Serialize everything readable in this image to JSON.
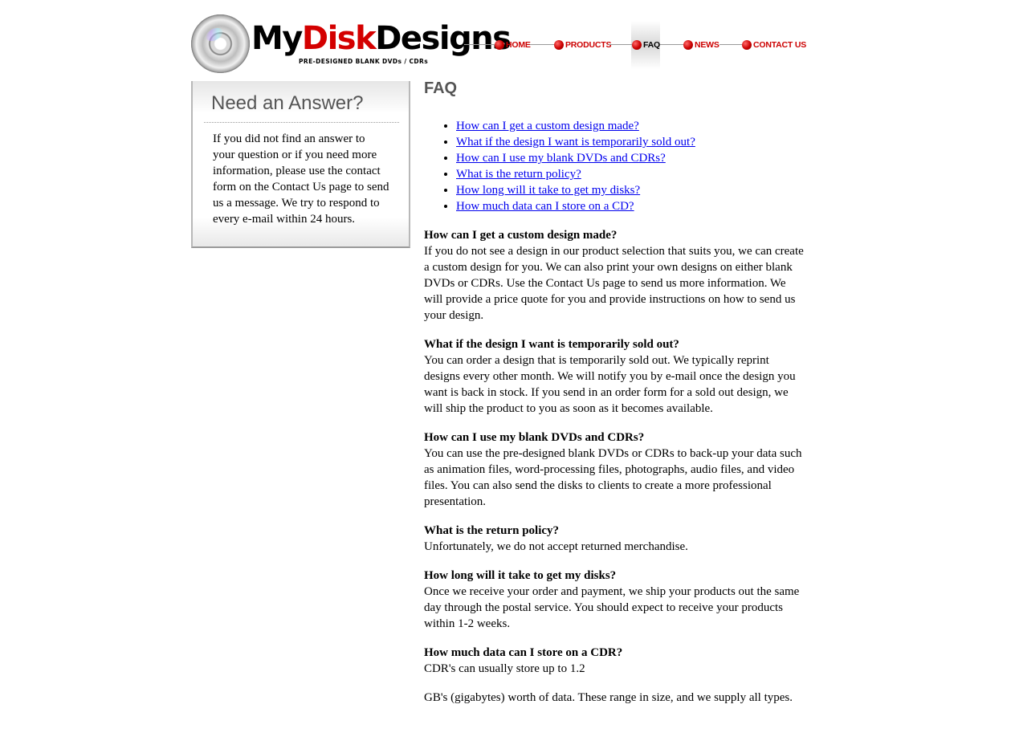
{
  "header": {
    "logo": {
      "my": "My",
      "disk": "Disk",
      "designs": "Designs"
    },
    "tagline": "PRE-DESIGNED BLANK DVDs / CDRs",
    "disc_icon": "cd-disc-icon"
  },
  "nav": {
    "items": [
      {
        "label": "HOME",
        "active": false
      },
      {
        "label": "PRODUCTS",
        "active": false
      },
      {
        "label": "FAQ",
        "active": true
      },
      {
        "label": "NEWS",
        "active": false
      },
      {
        "label": "CONTACT US",
        "active": false
      }
    ],
    "colors": {
      "accent": "#cc0000",
      "active_text": "#000000"
    }
  },
  "sidebar": {
    "title": "Need an Answer?",
    "text": "If you did not find an answer to your question or if you need more information, please use the contact form on the Contact Us page to send us a message. We try to respond to every e-mail within 24 hours."
  },
  "main": {
    "title": "FAQ",
    "toc": [
      "How can I get a custom design made?",
      "What if the design I want is temporarily sold out?",
      "How can I use my blank DVDs and CDRs?",
      "What is the return policy?",
      "How long will it take to get my disks?",
      "How much data can I store on a CD?"
    ],
    "faqs": [
      {
        "q": "How can I get a custom design made?",
        "a": "If you do not see a design in our product selection that suits you, we can create a custom design for you. We can also print your own designs on either blank DVDs or CDRs. Use the Contact Us page to send us more information. We will provide a price quote for you and provide instructions on how to send us your design."
      },
      {
        "q": "What if the design I want is temporarily sold out?",
        "a": "You can order a design that is temporarily sold out. We typically reprint designs every other month. We will notify you by e-mail once the design you want is back in stock. If you send in an order form for a sold out design, we will ship the product to you as soon as it becomes available."
      },
      {
        "q": "How can I use my blank DVDs and CDRs?",
        "a": "You can use the pre-designed blank DVDs or CDRs to back-up your data such as animation files, word-processing files, photographs, audio files, and video files. You can also send the disks to clients to create a more professional presentation."
      },
      {
        "q": "What is the return policy?",
        "a": "Unfortunately, we do not accept returned merchandise."
      },
      {
        "q": "How long will it take to get my disks?",
        "a": "Once we receive your order and payment, we ship your products out the same day through the postal service. You should expect to receive your products within 1-2 weeks."
      },
      {
        "q": "How much data can I store on a CDR?",
        "a": "CDR's can usually store up to 1.2",
        "extra": "GB's (gigabytes) worth of data. These range in size, and we supply all types."
      }
    ]
  }
}
